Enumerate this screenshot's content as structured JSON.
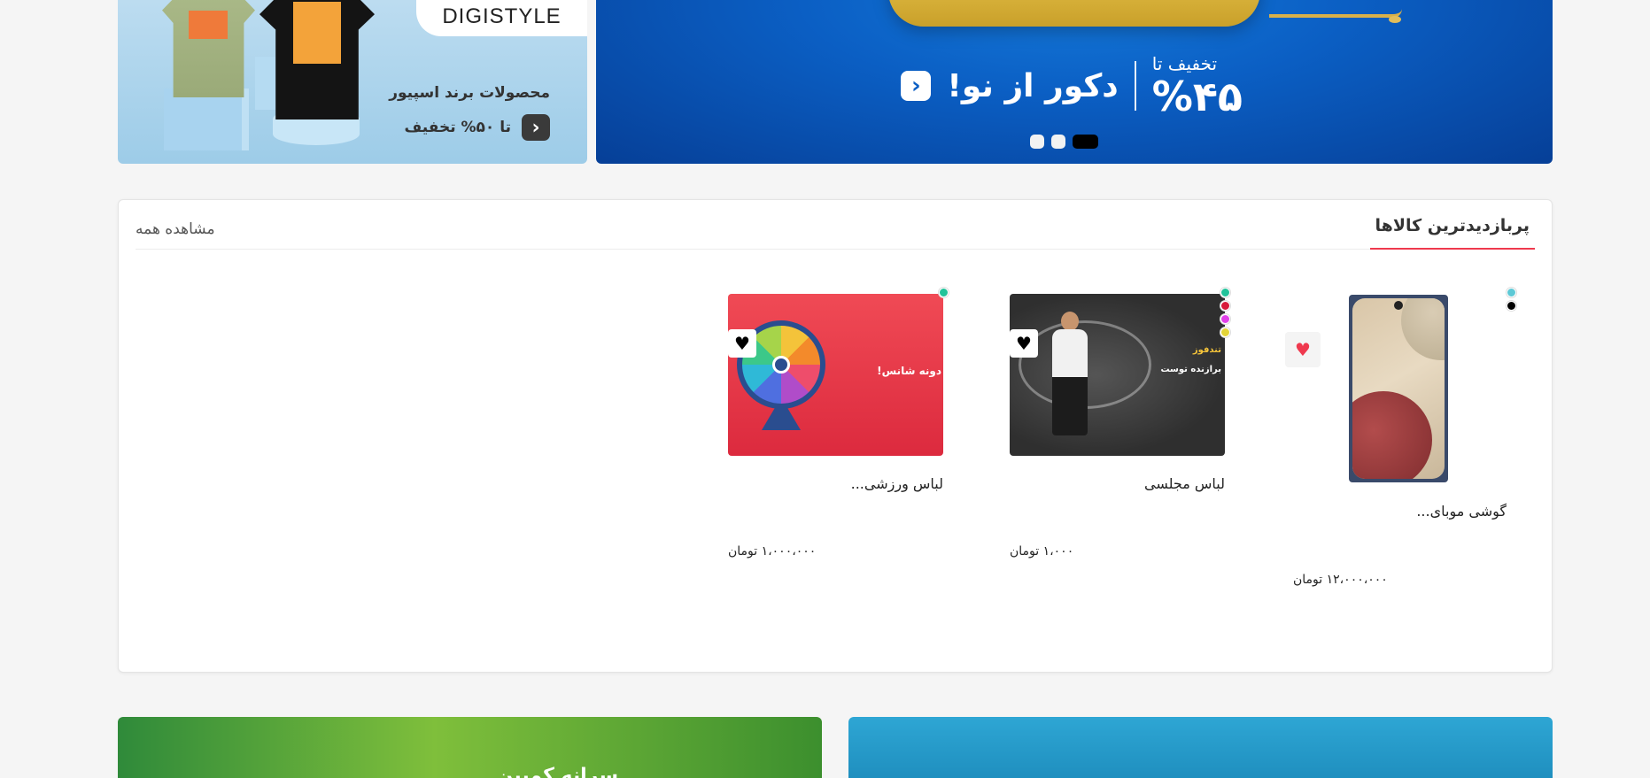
{
  "hero_banner": {
    "discount_prefix": "تخفیف تا",
    "discount_value": "%۴۵",
    "headline": "دکور از نو!",
    "arrow_icon": "chevron-left-icon",
    "slides": 3,
    "active_slide": 3
  },
  "side_banner": {
    "brand_label": "DIGISTYLE",
    "title": "محصولات برند اسپیور",
    "offer": "تا ۵۰% تخفیف",
    "arrow_icon": "chevron-left-icon"
  },
  "most_viewed": {
    "title": "پربازدیدترین کالاها",
    "view_all": "مشاهده همه",
    "accent_color": "#ef394e",
    "products": [
      {
        "name": "گوشی موبای...",
        "price": "۱۲،۰۰۰،۰۰۰ تومان",
        "favorite_icon": "heart-icon",
        "favorite_color": "#ef394e",
        "swatches": [
          "#5ec9d6",
          "#000000"
        ]
      },
      {
        "name": "لباس مجلسی",
        "price": "۱،۰۰۰ تومان",
        "favorite_icon": "heart-icon",
        "favorite_color": "#000000",
        "swatches": [
          "#22c39a",
          "#d8193a",
          "#e040e8",
          "#e3d437"
        ],
        "ad_headline": "برازنده توست",
        "ad_brand": "تندفوز"
      },
      {
        "name": "لباس ورزشی...",
        "price": "۱،۰۰۰،۰۰۰ تومان",
        "favorite_icon": "heart-icon",
        "favorite_color": "#000000",
        "swatches": [
          "#22c39a"
        ],
        "ad_headline": "دونه شانس!"
      }
    ]
  },
  "bottom_banners": {
    "green_text": "سرانه کمپین"
  }
}
